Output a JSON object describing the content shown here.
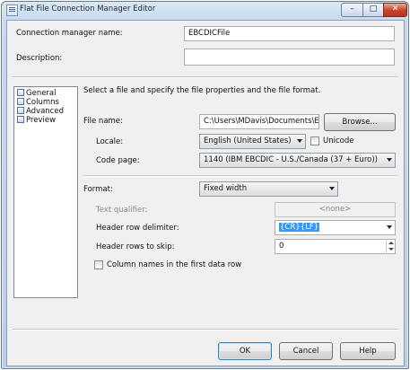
{
  "window": {
    "title": "Flat File Connection Manager Editor",
    "minimize": "–",
    "maximize": "□",
    "close": "✕"
  },
  "general": {
    "connection_name_label": "Connection manager name:",
    "connection_name_value": "EBCDICFile",
    "description_label": "Description:",
    "description_value": ""
  },
  "nav": {
    "items": [
      {
        "label": "General"
      },
      {
        "label": "Columns"
      },
      {
        "label": "Advanced"
      },
      {
        "label": "Preview"
      }
    ]
  },
  "main": {
    "instruction": "Select a file and specify the file properties and the file format.",
    "file_name_label": "File name:",
    "file_name_value": "C:\\Users\\MDavis\\Documents\\EBCDIC\\",
    "browse_label": "Browse...",
    "locale_label": "Locale:",
    "locale_value": "English (United States)",
    "unicode_label": "Unicode",
    "code_page_label": "Code page:",
    "code_page_value": "1140  (IBM EBCDIC - U.S./Canada (37 + Euro))",
    "format_label": "Format:",
    "format_value": "Fixed width",
    "text_qualifier_label": "Text qualifier:",
    "text_qualifier_value": "<none>",
    "header_delim_label": "Header row delimiter:",
    "header_delim_value": "{CR}{LF}",
    "header_skip_label": "Header rows to skip:",
    "header_skip_value": "0",
    "column_names_label": "Column names in the first data row"
  },
  "footer": {
    "ok": "OK",
    "cancel": "Cancel",
    "help": "Help"
  }
}
